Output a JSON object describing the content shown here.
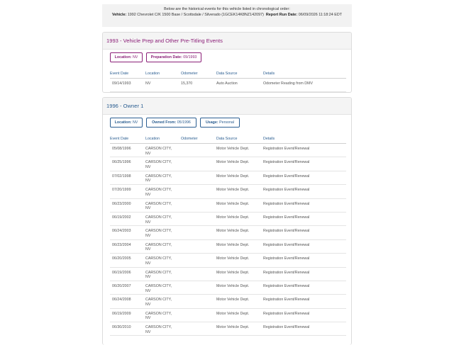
{
  "header": {
    "intro": "Below are the historical events for this vehicle listed in chronological order:",
    "vehicle_label": "Vehicle:",
    "vehicle_value": "1992 Chevrolet C/K 1500 Base / Scottsdale / Silverado (1GCEK14K8NZ142097)",
    "report_label": "Report Run Date:",
    "report_value": "06/09/2026 11:18:24 EDT"
  },
  "section1": {
    "title": "1993 - Vehicle Prep and Other Pre-Titling Events",
    "tags": [
      {
        "label": "Location:",
        "value": "NV"
      },
      {
        "label": "Preparation Date:",
        "value": "09/1993"
      }
    ],
    "columns": [
      "Event Date",
      "Location",
      "Odometer",
      "Data Source",
      "Details"
    ],
    "rows": [
      {
        "date": "09/14/1993",
        "location": "NV",
        "odometer": "15,370",
        "source": "Auto Auction",
        "details": "Odometer Reading from DMV"
      }
    ]
  },
  "section2": {
    "title": "1996 - Owner   1",
    "tags": [
      {
        "label": "Location:",
        "value": "NV"
      },
      {
        "label": "Owned From:",
        "value": "05/1996"
      },
      {
        "label": "Usage:",
        "value": "Personal"
      }
    ],
    "columns": [
      "Event Date",
      "Location",
      "Odometer",
      "Data Source",
      "Details"
    ],
    "rows": [
      {
        "date": "05/08/1996",
        "location": "CARSON CITY, NV",
        "odometer": "",
        "source": "Motor Vehicle Dept.",
        "details": "Registration Event/Renewal"
      },
      {
        "date": "06/25/1996",
        "location": "CARSON CITY, NV",
        "odometer": "",
        "source": "Motor Vehicle Dept.",
        "details": "Registration Event/Renewal"
      },
      {
        "date": "07/02/1998",
        "location": "CARSON CITY, NV",
        "odometer": "",
        "source": "Motor Vehicle Dept.",
        "details": "Registration Event/Renewal"
      },
      {
        "date": "07/20/1999",
        "location": "CARSON CITY, NV",
        "odometer": "",
        "source": "Motor Vehicle Dept.",
        "details": "Registration Event/Renewal"
      },
      {
        "date": "06/23/2000",
        "location": "CARSON CITY, NV",
        "odometer": "",
        "source": "Motor Vehicle Dept.",
        "details": "Registration Event/Renewal"
      },
      {
        "date": "06/19/2002",
        "location": "CARSON CITY, NV",
        "odometer": "",
        "source": "Motor Vehicle Dept.",
        "details": "Registration Event/Renewal"
      },
      {
        "date": "06/24/2003",
        "location": "CARSON CITY, NV",
        "odometer": "",
        "source": "Motor Vehicle Dept.",
        "details": "Registration Event/Renewal"
      },
      {
        "date": "06/23/2004",
        "location": "CARSON CITY, NV",
        "odometer": "",
        "source": "Motor Vehicle Dept.",
        "details": "Registration Event/Renewal"
      },
      {
        "date": "06/20/2005",
        "location": "CARSON CITY, NV",
        "odometer": "",
        "source": "Motor Vehicle Dept.",
        "details": "Registration Event/Renewal"
      },
      {
        "date": "06/19/2006",
        "location": "CARSON CITY, NV",
        "odometer": "",
        "source": "Motor Vehicle Dept.",
        "details": "Registration Event/Renewal"
      },
      {
        "date": "06/20/2007",
        "location": "CARSON CITY, NV",
        "odometer": "",
        "source": "Motor Vehicle Dept.",
        "details": "Registration Event/Renewal"
      },
      {
        "date": "06/24/2008",
        "location": "CARSON CITY, NV",
        "odometer": "",
        "source": "Motor Vehicle Dept.",
        "details": "Registration Event/Renewal"
      },
      {
        "date": "06/19/2009",
        "location": "CARSON CITY, NV",
        "odometer": "",
        "source": "Motor Vehicle Dept.",
        "details": "Registration Event/Renewal"
      },
      {
        "date": "06/30/2010",
        "location": "CARSON CITY, NV",
        "odometer": "",
        "source": "Motor Vehicle Dept.",
        "details": "Registration Event/Renewal"
      }
    ]
  }
}
